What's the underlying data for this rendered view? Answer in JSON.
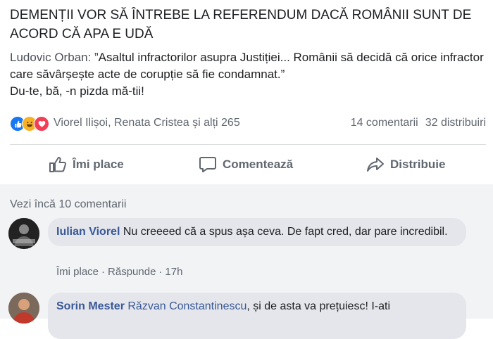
{
  "post": {
    "headline": "DEMENȚII VOR SĂ ÎNTREBE LA REFERENDUM DACĂ ROMÂNII SUNT DE ACORD CĂ APA E UDĂ",
    "quote_author": "Ludovic Orban:",
    "quote_text": " ”Asaltul infractorilor asupra Justiției... Românii să decidă că orice infractor care săvârșește acte de corupție să fie condamnat.”",
    "reply_line": "Du-te, bă, -n pizda mă-tii!"
  },
  "reactions": {
    "reactors": "Viorel Ilișoi, Renata Cristea și alți 265",
    "comments_count": "14 comentarii",
    "shares_count": "32 distribuiri"
  },
  "actions": {
    "like": "Îmi place",
    "comment": "Comentează",
    "share": "Distribuie"
  },
  "comments_section": {
    "more_link": "Vezi încă 10 comentarii",
    "comments": [
      {
        "author": "Iulian Viorel",
        "text": " Nu creeeed că a spus așa ceva. De fapt cred, dar pare incredibil.",
        "like": "Îmi place",
        "reply": "Răspunde",
        "time": "17h"
      },
      {
        "author": "Sorin Mester",
        "mention": "Răzvan Constantinescu",
        "text": ", și de asta va prețuiesc! I-ati"
      }
    ]
  },
  "colors": {
    "link": "#385898",
    "like_blue": "#1877f2",
    "muted": "#606770"
  },
  "icons": [
    "like-reaction-icon",
    "haha-reaction-icon",
    "love-reaction-icon",
    "thumbs-up-icon",
    "comment-icon",
    "share-icon"
  ]
}
